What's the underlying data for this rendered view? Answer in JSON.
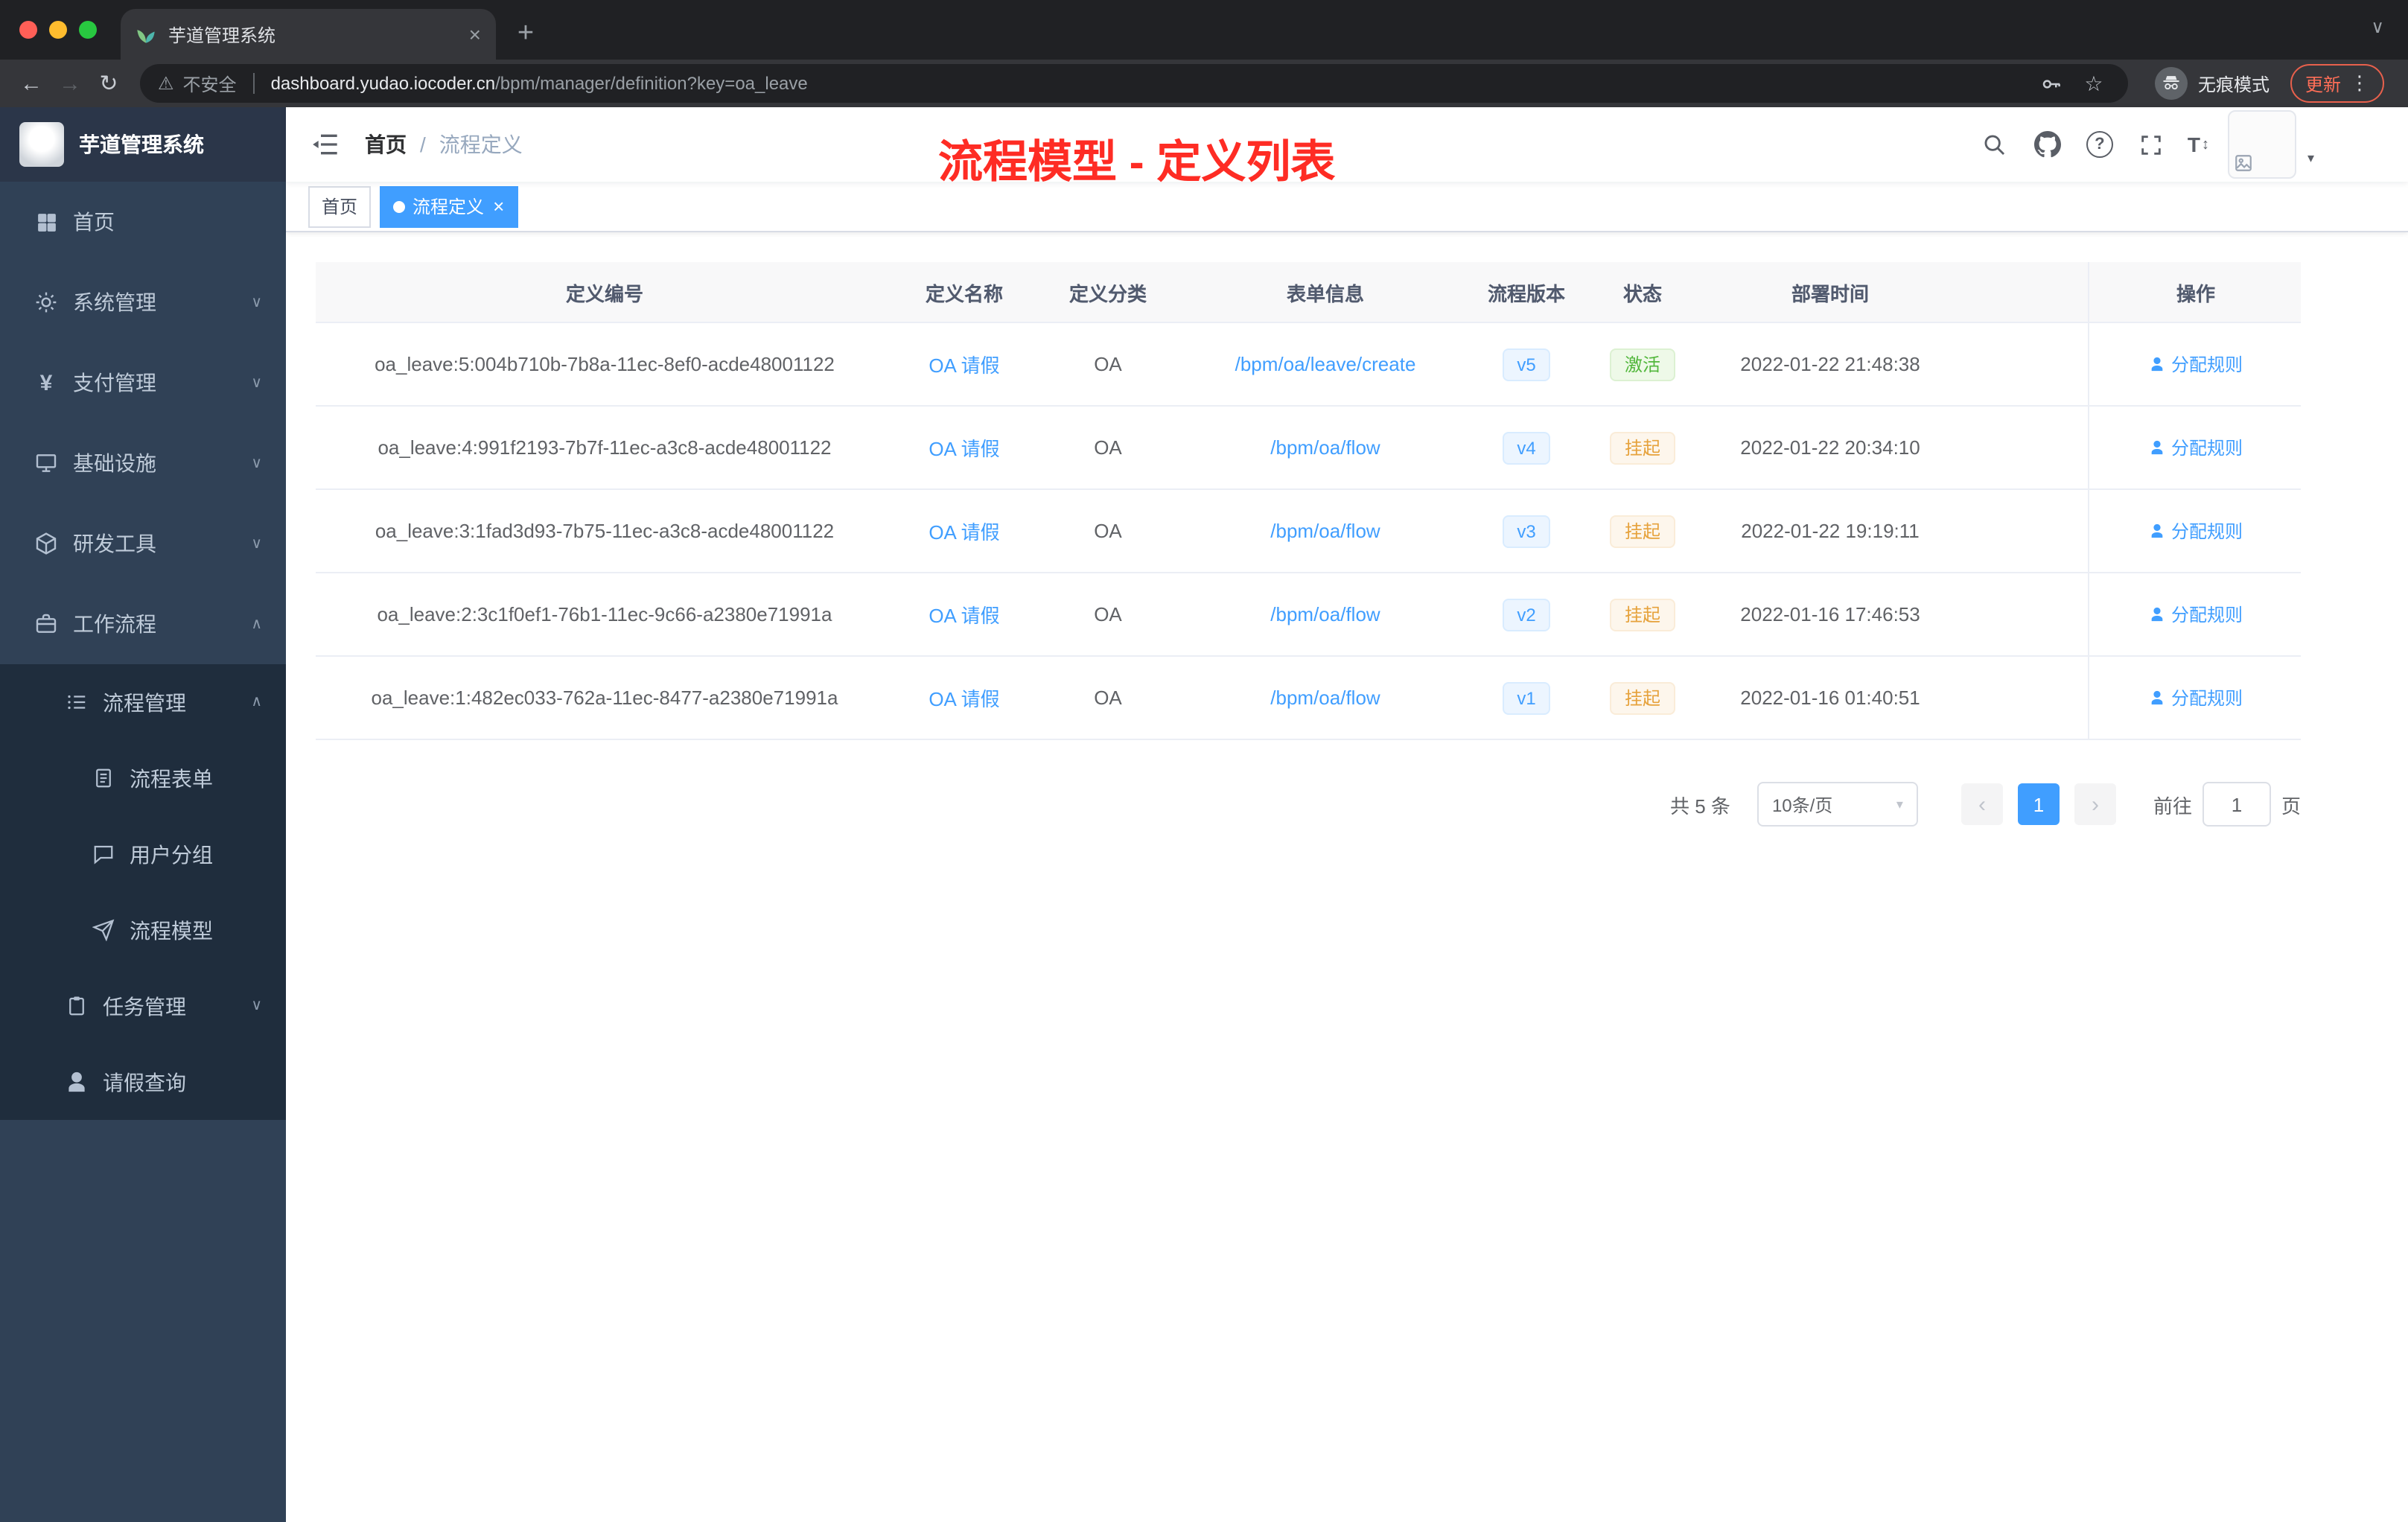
{
  "browser": {
    "tab_title": "芋道管理系统",
    "security_label": "不安全",
    "url_domain": "dashboard.yudao.iocoder.cn",
    "url_path": "/bpm/manager/definition?key=oa_leave",
    "incognito_label": "无痕模式",
    "update_label": "更新"
  },
  "icons": {
    "close": "×",
    "plus": "+",
    "back": "←",
    "forward": "→",
    "reload": "↻",
    "warning": "⚠",
    "star": "☆",
    "kebab": "⋮",
    "chevron_down": "∨",
    "chevron_up": "∧",
    "caret_down": "▾",
    "yen": "¥",
    "question": "?",
    "font_size": "T",
    "updown": "↕",
    "prev": "‹",
    "next": "›",
    "slash": "/"
  },
  "sidebar": {
    "app_title": "芋道管理系统",
    "menu": [
      {
        "label": "首页"
      },
      {
        "label": "系统管理"
      },
      {
        "label": "支付管理"
      },
      {
        "label": "基础设施"
      },
      {
        "label": "研发工具"
      },
      {
        "label": "工作流程"
      }
    ],
    "submenu": [
      {
        "label": "流程管理"
      },
      {
        "label": "流程表单"
      },
      {
        "label": "用户分组"
      },
      {
        "label": "流程模型"
      },
      {
        "label": "任务管理"
      },
      {
        "label": "请假查询"
      }
    ]
  },
  "header": {
    "breadcrumb_home": "首页",
    "breadcrumb_current": "流程定义",
    "annotation": "流程模型 - 定义列表"
  },
  "tags": {
    "home": "首页",
    "current": "流程定义"
  },
  "table": {
    "columns": {
      "id": "定义编号",
      "name": "定义名称",
      "category": "定义分类",
      "form": "表单信息",
      "version": "流程版本",
      "status": "状态",
      "time": "部署时间",
      "action": "操作"
    },
    "rows": [
      {
        "id": "oa_leave:5:004b710b-7b8a-11ec-8ef0-acde48001122",
        "name": "OA 请假",
        "category": "OA",
        "form": "/bpm/oa/leave/create",
        "version": "v5",
        "status": "激活",
        "status_type": "success",
        "time": "2022-01-22 21:48:38",
        "action": "分配规则"
      },
      {
        "id": "oa_leave:4:991f2193-7b7f-11ec-a3c8-acde48001122",
        "name": "OA 请假",
        "category": "OA",
        "form": "/bpm/oa/flow",
        "version": "v4",
        "status": "挂起",
        "status_type": "warning",
        "time": "2022-01-22 20:34:10",
        "action": "分配规则"
      },
      {
        "id": "oa_leave:3:1fad3d93-7b75-11ec-a3c8-acde48001122",
        "name": "OA 请假",
        "category": "OA",
        "form": "/bpm/oa/flow",
        "version": "v3",
        "status": "挂起",
        "status_type": "warning",
        "time": "2022-01-22 19:19:11",
        "action": "分配规则"
      },
      {
        "id": "oa_leave:2:3c1f0ef1-76b1-11ec-9c66-a2380e71991a",
        "name": "OA 请假",
        "category": "OA",
        "form": "/bpm/oa/flow",
        "version": "v2",
        "status": "挂起",
        "status_type": "warning",
        "time": "2022-01-16 17:46:53",
        "action": "分配规则"
      },
      {
        "id": "oa_leave:1:482ec033-762a-11ec-8477-a2380e71991a",
        "name": "OA 请假",
        "category": "OA",
        "form": "/bpm/oa/flow",
        "version": "v1",
        "status": "挂起",
        "status_type": "warning",
        "time": "2022-01-16 01:40:51",
        "action": "分配规则"
      }
    ]
  },
  "pagination": {
    "total": "共 5 条",
    "page_size": "10条/页",
    "page": "1",
    "goto": "前往",
    "goto_value": "1",
    "unit": "页"
  },
  "colors": {
    "accent": "#409eff",
    "success": "#67c23a",
    "warning": "#e6a23c",
    "annotation": "#fe2c24",
    "sidebar": "#304156",
    "submenu": "#1f2d3d"
  }
}
